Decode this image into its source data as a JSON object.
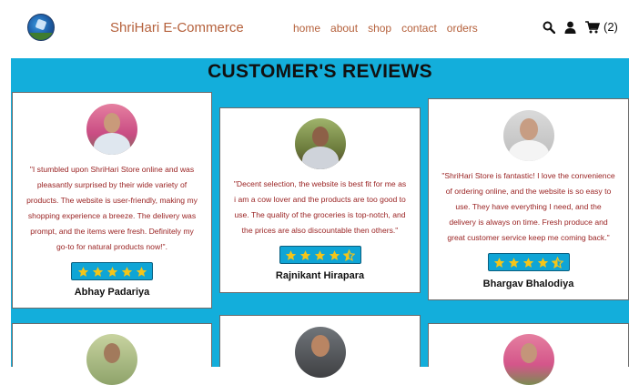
{
  "header": {
    "brand": "ShriHari E-Commerce",
    "nav": [
      "home",
      "about",
      "shop",
      "contact",
      "orders"
    ],
    "cart_count": "(2)"
  },
  "icons": [
    "logo-icon",
    "search-icon",
    "user-icon",
    "cart-icon",
    "star-icon",
    "star-half-icon"
  ],
  "colors": {
    "accent": "#b5613c",
    "section_bg": "#13aedb",
    "quote": "#9a2323",
    "stars_bg": "#0fa5d6",
    "star": "#f5c518"
  },
  "reviews": {
    "title": "CUSTOMER'S REVIEWS",
    "items": [
      {
        "quote": "\"I stumbled upon ShriHari Store online and was pleasantly surprised by their wide variety of products. The website is user-friendly, making my shopping experience a breeze. The delivery was prompt, and the items were fresh. Definitely my go-to for natural products now!\".",
        "rating": 5,
        "name": "Abhay Padariya"
      },
      {
        "quote": "\"Decent selection, the website is best fit for me as i am a cow lover and the products are too good to use. The quality of the groceries is top-notch, and the prices are also discountable then others.\"",
        "rating": 4.5,
        "name": "Rajnikant Hirapara"
      },
      {
        "quote": "\"ShriHari Store is fantastic! I love the convenience of ordering online, and the website is so easy to use. They have everything I need, and the delivery is always on time. Fresh produce and great customer service keep me coming back.\"",
        "rating": 4.5,
        "name": "Bhargav Bhalodiya"
      }
    ]
  }
}
